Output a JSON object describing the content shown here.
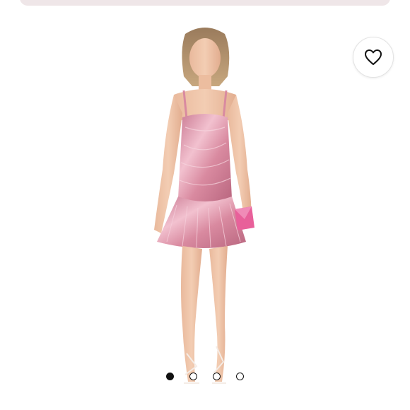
{
  "header": {
    "bar_color": "#efe6e8"
  },
  "product": {
    "dress_color": "#d98aa0",
    "clutch_color": "#e8609a"
  },
  "favorite": {
    "icon": "heart-outline-icon"
  },
  "carousel": {
    "total": 4,
    "active_index": 0
  }
}
